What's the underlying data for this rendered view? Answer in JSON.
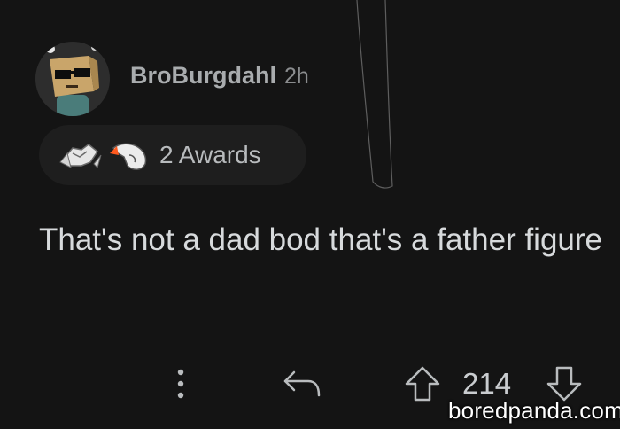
{
  "comment": {
    "username": "BroBurgdahl",
    "timestamp": "2h",
    "awards_label": "2 Awards",
    "text": "That's not a dad bod that's a father figure",
    "vote_count": "214"
  },
  "icons": {
    "avatar": "snoo-avatar-cardboard-box-sunglasses",
    "award1": "handshake-award-icon",
    "award2": "pointing-hand-award-icon",
    "more": "vertical-dots-icon",
    "reply": "reply-arrow-icon",
    "upvote": "upvote-arrow-icon",
    "downvote": "downvote-arrow-icon"
  },
  "watermark": "boredpanda.com",
  "colors": {
    "background": "#141414",
    "text_primary": "#d7dadc",
    "text_muted": "#a9acae",
    "pill_background": "#1e1e1e"
  }
}
